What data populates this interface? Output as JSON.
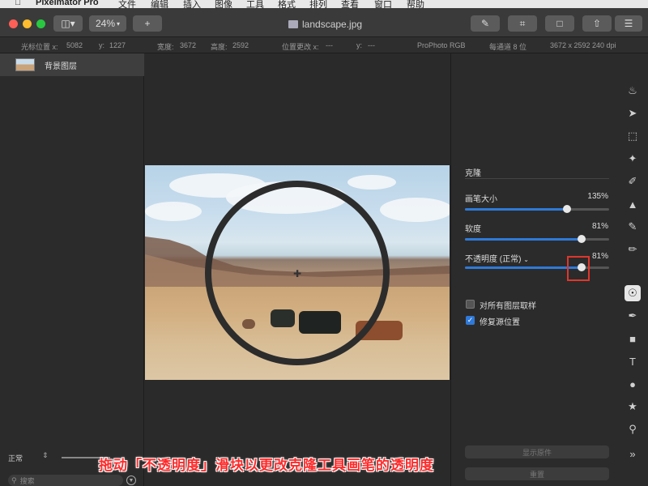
{
  "menubar": {
    "app_name": "Pixelmator Pro",
    "items": [
      "文件",
      "编辑",
      "插入",
      "图像",
      "工具",
      "格式",
      "排列",
      "查看",
      "窗口",
      "帮助"
    ]
  },
  "toolbar": {
    "zoom": "24%",
    "add_label": "+",
    "document_title": "landscape.jpg"
  },
  "infobar": {
    "cursor_x_label": "光标位置 x:",
    "cursor_x": "5082",
    "cursor_y_label": "y:",
    "cursor_y": "1227",
    "width_label": "宽度:",
    "width": "3672",
    "height_label": "高度:",
    "height": "2592",
    "change_x_label": "位置更改 x:",
    "change_x": "---",
    "change_y_label": "y:",
    "change_y": "---",
    "color_profile": "ProPhoto RGB",
    "bit_depth": "每通道 8 位",
    "dimensions": "3672 x 2592 240 dpi"
  },
  "layers": {
    "items": [
      {
        "name": "背景图层"
      }
    ],
    "blend_mode": "正常",
    "search_placeholder": "搜索"
  },
  "clone_panel": {
    "title": "克隆",
    "brush_size": {
      "label": "画笔大小",
      "value": "135%",
      "level": 0.71
    },
    "softness": {
      "label": "软度",
      "value": "81%",
      "level": 0.81
    },
    "opacity": {
      "label": "不透明度 (正常)",
      "value": "81%",
      "level": 0.81
    },
    "sample_all_layers": {
      "label": "对所有图层取样",
      "checked": false
    },
    "restore_source": {
      "label": "修复源位置",
      "checked": true
    },
    "show_original_label": "显示原件",
    "reset_label": "重置"
  },
  "tools": [
    "paint-bucket-icon",
    "arrow-icon",
    "marquee-icon",
    "magic-wand-icon",
    "brush-icon",
    "fill-icon",
    "eraser-icon",
    "pencil-icon",
    "clone-icon",
    "pen-icon",
    "shape-icon",
    "text-icon",
    "effects-icon",
    "star-icon",
    "zoom-icon",
    "more-icon"
  ],
  "caption": "拖动「不透明度」滑块以更改克隆工具画笔的透明度",
  "colors": {
    "accent": "#2f7ad9",
    "highlight": "#e0362c",
    "caption": "#ff2a2a"
  }
}
